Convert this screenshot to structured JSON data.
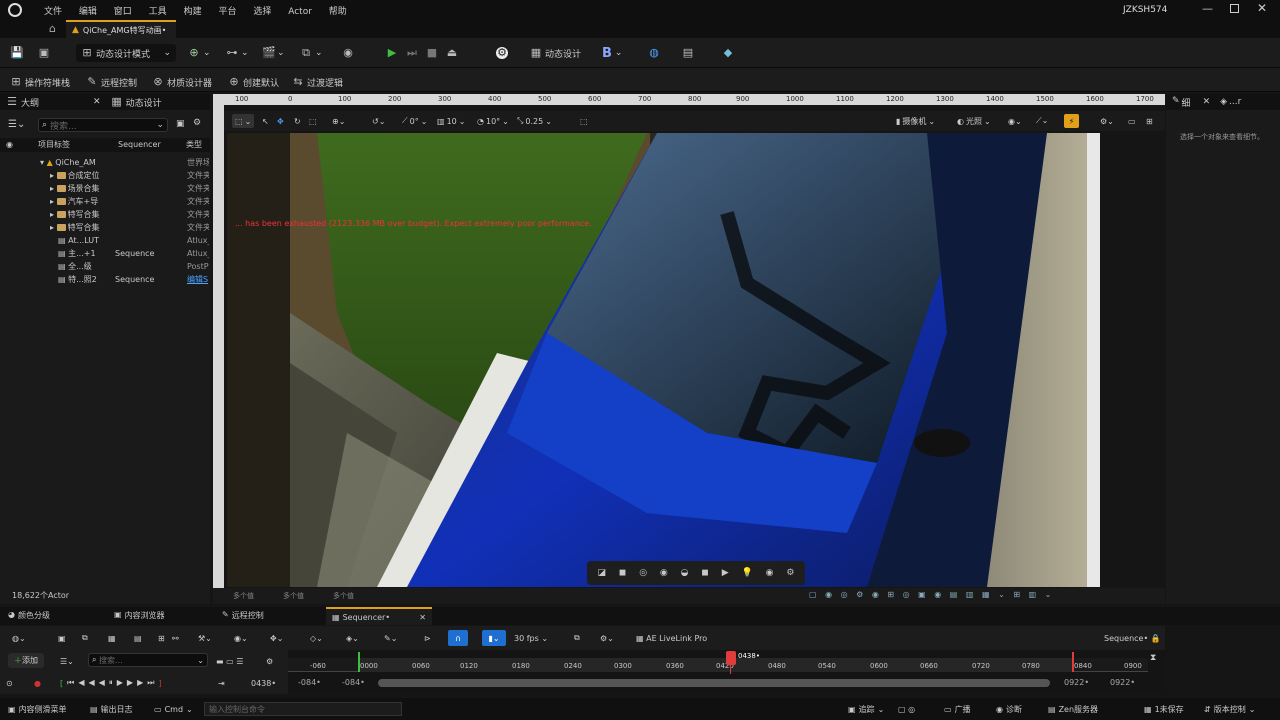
{
  "title_bar": {
    "menu": [
      "文件",
      "编辑",
      "窗口",
      "工具",
      "构建",
      "平台",
      "选择",
      "Actor",
      "帮助"
    ],
    "user": "JZKSH574"
  },
  "doc_tab": "QiChe_AMG特写动画•",
  "toolbar": {
    "mode": "动态设计模式",
    "sequencer_btn": "动态设计"
  },
  "toolbar2": {
    "items": [
      "操作符堆栈",
      "远程控制",
      "材质设计器",
      "创建默认",
      "过渡逻辑"
    ]
  },
  "outliner": {
    "tab1": "大纲",
    "tab2": "动态设计",
    "search_placeholder": "搜索...",
    "col_label": "项目标签",
    "col_seq": "Sequencer",
    "col_type": "类型",
    "rows": [
      {
        "label": "QiChe_AM",
        "seq": "",
        "type": "世界场"
      },
      {
        "label": "合成定位",
        "seq": "",
        "type": "文件夹"
      },
      {
        "label": "场景合集",
        "seq": "",
        "type": "文件夹"
      },
      {
        "label": "汽车+导",
        "seq": "",
        "type": "文件夹"
      },
      {
        "label": "特写合集",
        "seq": "",
        "type": "文件夹"
      },
      {
        "label": "特写合集",
        "seq": "",
        "type": "文件夹"
      },
      {
        "label": "At...LUT",
        "seq": "",
        "type": "Atlux_"
      },
      {
        "label": "主...+1",
        "seq": "Sequence",
        "type": "Atlux_"
      },
      {
        "label": "全...级",
        "seq": "",
        "type": "PostP"
      },
      {
        "label": "特...照2",
        "seq": "Sequence",
        "type": "编辑S"
      }
    ],
    "actor_count": "18,622个Actor"
  },
  "ruler": [
    "100",
    "0",
    "100",
    "200",
    "300",
    "400",
    "500",
    "600",
    "700",
    "800",
    "900",
    "1000",
    "1100",
    "1200",
    "1300",
    "1400",
    "1500",
    "1600",
    "1700"
  ],
  "viewport_toolbar": {
    "angle": "0°",
    "grid": "10",
    "rot": "10°",
    "scale": "0.25",
    "camera": "摄像机",
    "lit": "光照"
  },
  "warning": "... has been exhausted (2123.336 MB over budget). Expect extremely poor performance.",
  "multi_value": [
    "多个值",
    "多个值",
    "多个值"
  ],
  "right_panel": {
    "tab1": "细",
    "tab2": "...r",
    "hint": "选择一个对象来查看细节。"
  },
  "bottom_tabs": [
    "颜色分级",
    "内容浏览器",
    "远程控制",
    "Sequencer•"
  ],
  "sequencer": {
    "fps": "30 fps",
    "livelink": "AE LiveLink Pro",
    "seq_name": "Sequence•",
    "add": "添加",
    "search_placeholder": "搜索...",
    "current_frame": "0438•",
    "frame_field": "0438•",
    "start1": "-084•",
    "start2": "-084•",
    "end1": "0922•",
    "end2": "0922•",
    "ticks": [
      "-060",
      "0000",
      "0060",
      "0120",
      "0180",
      "0240",
      "0300",
      "0360",
      "0420",
      "0480",
      "0540",
      "0600",
      "0660",
      "0720",
      "0780",
      "0840",
      "0900"
    ]
  },
  "status_bar": {
    "drawer": "内容侧滑菜单",
    "log": "输出日志",
    "cmd": "Cmd",
    "console_placeholder": "输入控制台命令",
    "track": "追踪",
    "broadcast": "广播",
    "diag": "诊断",
    "zen": "Zen服务器",
    "unsaved": "1未保存",
    "vcs": "版本控制"
  },
  "colors": {
    "accent_orange": "#e0a019",
    "play_green": "#3fbf3f",
    "select_blue": "#1f6fd1",
    "playhead_red": "#e23b3b"
  }
}
